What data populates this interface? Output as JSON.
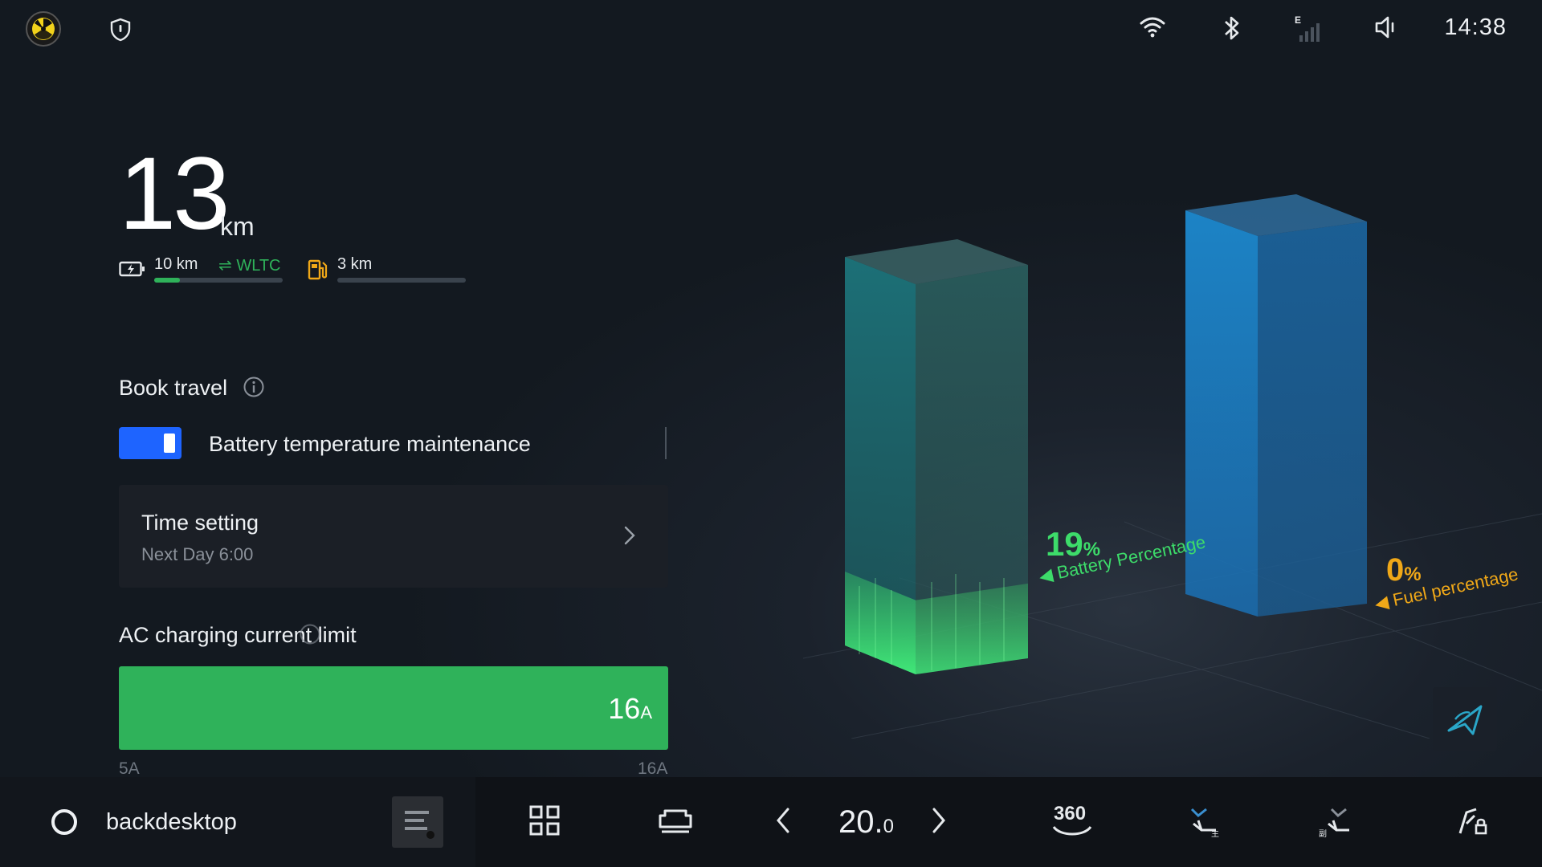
{
  "status_bar": {
    "time": "14:38",
    "signal_label": "E"
  },
  "range": {
    "total_value": "13",
    "total_unit": "km",
    "electric_value": "10 km",
    "wltc_label": "WLTC",
    "fuel_value": "3 km",
    "electric_progress": 0.2,
    "fuel_progress": 0.0
  },
  "book_travel": {
    "title": "Book travel",
    "battery_maintenance_label": "Battery temperature maintenance",
    "battery_maintenance_on": true,
    "time_setting_title": "Time setting",
    "time_setting_value": "Next Day 6:00"
  },
  "ac_charging": {
    "title": "AC charging current limit",
    "value": "16",
    "unit": "A",
    "min_label": "5A",
    "max_label": "16A"
  },
  "levels": {
    "battery_value": "19",
    "battery_unit": "%",
    "battery_label": "Battery Percentage",
    "battery_fraction": 0.19,
    "fuel_value": "0",
    "fuel_unit": "%",
    "fuel_label": "Fuel percentage",
    "fuel_fraction": 0.0
  },
  "dock": {
    "home_label": "backdesktop",
    "temperature_main": "20.",
    "temperature_decimal": "0",
    "camera_label": "360"
  },
  "colors": {
    "accent_blue": "#1e64ff",
    "green": "#2fb25a",
    "fuel_yellow": "#f0a818",
    "battery_green": "#3ddc6a"
  }
}
